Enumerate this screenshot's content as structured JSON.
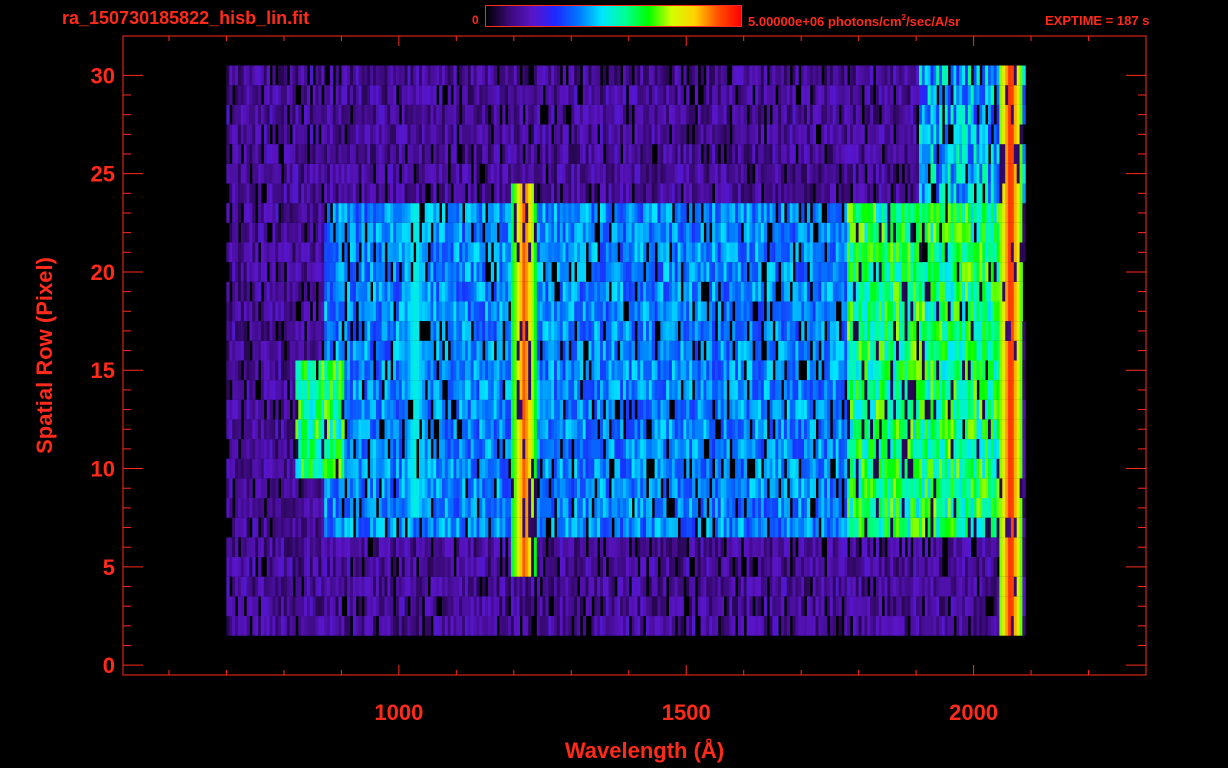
{
  "header": {
    "file_name": "ra_150730185822_hisb_lin.fit",
    "colorbar_min": "0",
    "colorbar_max_value": "5.00000e+06 photons/cm",
    "colorbar_max_exp": "2",
    "colorbar_max_unit": "/sec/A/sr",
    "exptime": "EXPTIME = 187 s"
  },
  "colors": {
    "axis": "#ff2a1a",
    "background": "#000000",
    "colormap": [
      "#000000",
      "#3a0a78",
      "#5a14c8",
      "#1e28ff",
      "#0078ff",
      "#00e6ff",
      "#00ff96",
      "#00ff00",
      "#d2ff00",
      "#ffd200",
      "#ff5000",
      "#ff0000"
    ]
  },
  "chart_data": {
    "type": "heatmap",
    "title": "ra_150730185822_hisb_lin.fit",
    "xlabel": "Wavelength (Å)",
    "ylabel": "Spatial Row (Pixel)",
    "xlim": [
      520,
      2300
    ],
    "ylim": [
      -0.5,
      32
    ],
    "xticks": [
      1000,
      1500,
      2000
    ],
    "yticks": [
      0,
      5,
      10,
      15,
      20,
      25,
      30
    ],
    "x_tick_labels": [
      "1000",
      "1500",
      "2000"
    ],
    "y_tick_labels": [
      "0",
      "5",
      "10",
      "15",
      "20",
      "25",
      "30"
    ],
    "colorbar": {
      "min": 0,
      "max": 5000000,
      "unit": "photons/cm^2/sec/A/sr"
    },
    "grid": false,
    "rows": [
      2,
      30
    ],
    "wavelength_range": [
      700,
      2090
    ],
    "features": [
      {
        "kind": "emission_line",
        "wavelength": 1216,
        "rows": [
          5,
          24
        ],
        "level": 0.92
      },
      {
        "kind": "emission_line",
        "wavelength": 1026,
        "rows": [
          8,
          23
        ],
        "level": 0.5
      },
      {
        "kind": "emission_line",
        "wavelength": 2062,
        "rows": [
          2,
          30
        ],
        "level": 0.97
      },
      {
        "kind": "continuum",
        "wavelength_range": [
          1780,
          2060
        ],
        "rows": [
          7,
          23
        ],
        "level": 0.62
      },
      {
        "kind": "continuum",
        "wavelength_range": [
          870,
          1780
        ],
        "rows": [
          7,
          23
        ],
        "level": 0.4
      },
      {
        "kind": "bright_patch",
        "wavelength_range": [
          820,
          900
        ],
        "rows": [
          10,
          15
        ],
        "level": 0.62
      }
    ]
  }
}
